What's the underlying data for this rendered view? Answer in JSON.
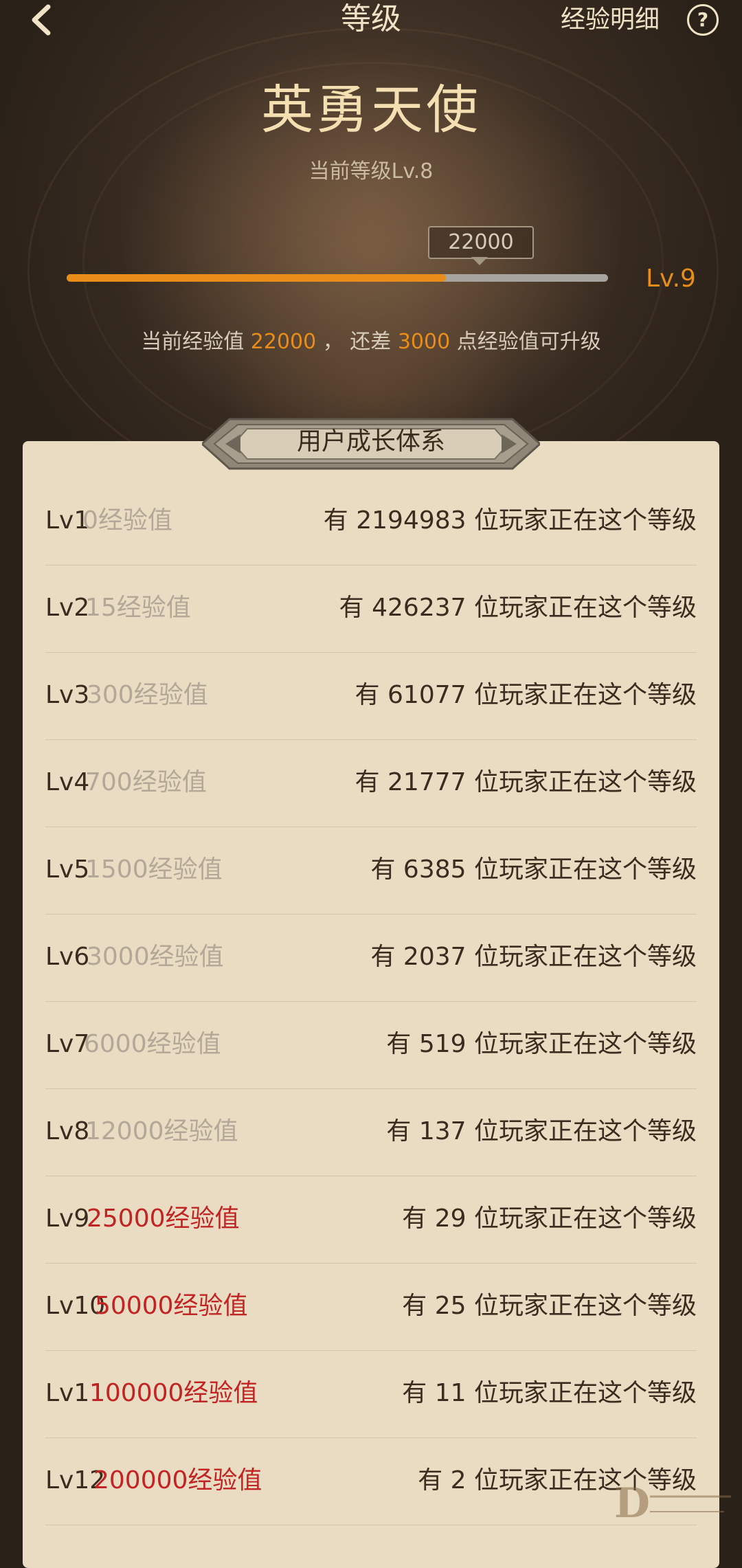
{
  "header": {
    "back_icon": "chevron-left-icon",
    "title": "等级",
    "exp_detail_label": "经验明细",
    "help_label": "?"
  },
  "rank": {
    "name": "英勇天使",
    "current_level": "当前等级Lv.8"
  },
  "progress": {
    "fraction": 0.7,
    "tip": "22000",
    "next_level": "Lv.9"
  },
  "summary": {
    "prefix": "当前经验值 ",
    "current_exp": "22000",
    "middle": " ， 还差 ",
    "remaining": "3000",
    "suffix": " 点经验值可升级"
  },
  "section": {
    "title": "用户成长体系"
  },
  "levels": [
    {
      "lv": "Lv1",
      "exp": "0经验值",
      "players": "有 2194983 位玩家正在这个等级",
      "reached": true
    },
    {
      "lv": "Lv2",
      "exp": "15经验值",
      "players": "有 426237 位玩家正在这个等级",
      "reached": true
    },
    {
      "lv": "Lv3",
      "exp": "300经验值",
      "players": "有 61077 位玩家正在这个等级",
      "reached": true
    },
    {
      "lv": "Lv4",
      "exp": "700经验值",
      "players": "有 21777 位玩家正在这个等级",
      "reached": true
    },
    {
      "lv": "Lv5",
      "exp": "1500经验值",
      "players": "有 6385 位玩家正在这个等级",
      "reached": true
    },
    {
      "lv": "Lv6",
      "exp": "3000经验值",
      "players": "有 2037 位玩家正在这个等级",
      "reached": true
    },
    {
      "lv": "Lv7",
      "exp": "6000经验值",
      "players": "有 519 位玩家正在这个等级",
      "reached": true
    },
    {
      "lv": "Lv8",
      "exp": "12000经验值",
      "players": "有 137 位玩家正在这个等级",
      "reached": true
    },
    {
      "lv": "Lv9",
      "exp": "25000经验值",
      "players": "有 29 位玩家正在这个等级",
      "reached": false
    },
    {
      "lv": "Lv10",
      "exp": "50000经验值",
      "players": "有 25 位玩家正在这个等级",
      "reached": false
    },
    {
      "lv": "Lv11",
      "exp": "100000经验值",
      "players": "有 11 位玩家正在这个等级",
      "reached": false
    },
    {
      "lv": "Lv12",
      "exp": "200000经验值",
      "players": "有 2 位玩家正在这个等级",
      "reached": false
    }
  ],
  "colors": {
    "accent": "#e88d1a",
    "locked_exp": "#c22424",
    "reached_exp": "#b3a897",
    "card_bg": "#e9dcc3",
    "title_gold": "#f3dfb2"
  }
}
